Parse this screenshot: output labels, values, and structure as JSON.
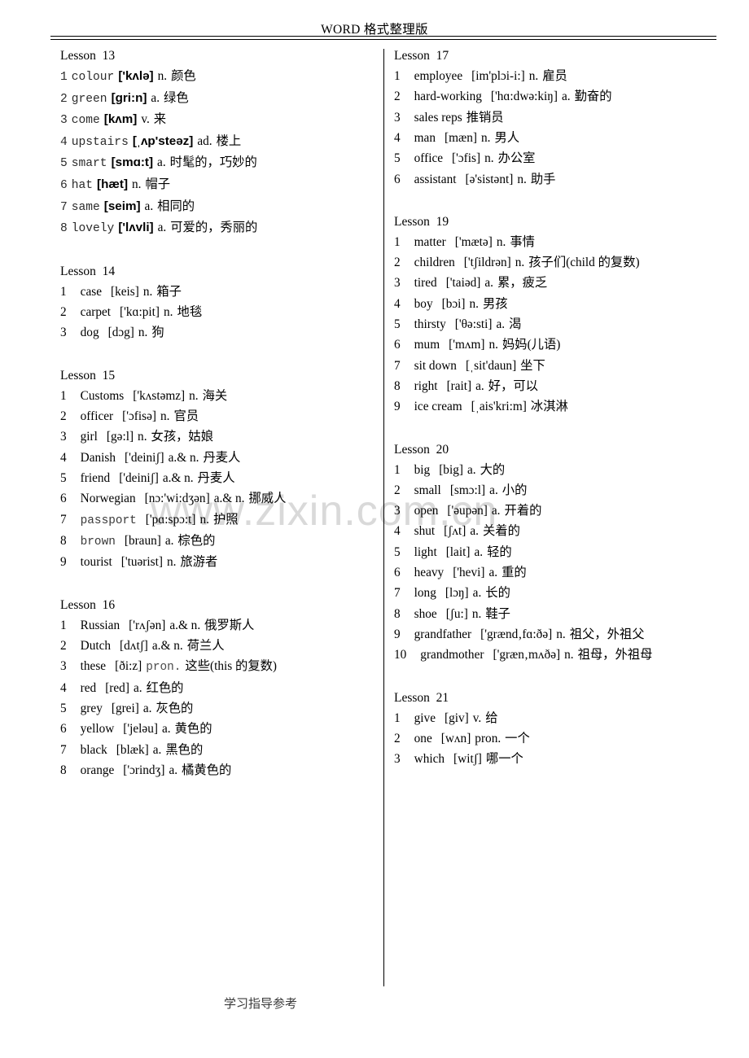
{
  "header": {
    "title": "WORD 格式整理版"
  },
  "footer": {
    "text": "学习指导参考"
  },
  "watermark": {
    "text": "www.zixin.com.cn"
  },
  "left_column": {
    "lessons": [
      {
        "title": "Lesson  13",
        "style": "mono",
        "entries": [
          {
            "num": "1",
            "word": "colour",
            "ipa": "['kʌlə]",
            "pos": "n.",
            "cn": "颜色"
          },
          {
            "num": "2",
            "word": "green",
            "ipa": "[gri:n]",
            "pos": "a.",
            "cn": "绿色"
          },
          {
            "num": "3",
            "word": "come",
            "ipa": "[kʌm]",
            "pos": "v.",
            "cn": "来"
          },
          {
            "num": "4",
            "word": "upstairs",
            "ipa": "[ˌʌp'steəz]",
            "pos": "ad.",
            "cn": "楼上"
          },
          {
            "num": "5",
            "word": "smart",
            "ipa": "[smɑ:t]",
            "pos": "a.",
            "cn": "时髦的，巧妙的"
          },
          {
            "num": "6",
            "word": "hat",
            "ipa": "[hæt]",
            "pos": "n.",
            "cn": "帽子"
          },
          {
            "num": "7",
            "word": "same",
            "ipa": "[seim]",
            "pos": "a.",
            "cn": "相同的"
          },
          {
            "num": "8",
            "word": "lovely",
            "ipa": "['lʌvli]",
            "pos": "a.",
            "cn": "可爱的，秀丽的"
          }
        ]
      },
      {
        "title": "Lesson  14",
        "style": "serif",
        "entries": [
          {
            "num": "1",
            "word": "case",
            "ipa": "[keis]",
            "pos": "n.",
            "cn": "箱子"
          },
          {
            "num": "2",
            "word": "carpet",
            "ipa": "['kɑ:pit]",
            "pos": "n.",
            "cn": "地毯"
          },
          {
            "num": "3",
            "word": "dog",
            "ipa": "[dɔg]",
            "pos": "n.",
            "cn": "狗"
          }
        ]
      },
      {
        "title": "Lesson  15",
        "style": "serif",
        "entries": [
          {
            "num": "1",
            "word": "Customs",
            "ipa": "['kʌstəmz]",
            "pos": "n.",
            "cn": "海关"
          },
          {
            "num": "2",
            "word": "officer",
            "ipa": "['ɔfisə]",
            "pos": "n.",
            "cn": "官员"
          },
          {
            "num": "3",
            "word": "girl",
            "ipa": "[gə:l]",
            "pos": "n.",
            "cn": "女孩，姑娘"
          },
          {
            "num": "4",
            "word": "Danish",
            "ipa": "['deiniʃ]",
            "pos": "a.& n.",
            "cn": "丹麦人"
          },
          {
            "num": "5",
            "word": "friend",
            "ipa": "['deiniʃ]",
            "pos": "a.& n.",
            "cn": "丹麦人"
          },
          {
            "num": "6",
            "word": "Norwegian",
            "ipa": "[nɔ:'wi:dʒən]",
            "pos": "a.& n.",
            "cn": "挪威人"
          },
          {
            "num": "7",
            "word": "passport",
            "ipa": "['pɑ:spɔ:t]",
            "pos": "n.",
            "cn": "护照",
            "word_style": "mono"
          },
          {
            "num": "8",
            "word": "brown",
            "ipa": "[braun]",
            "pos": "a.",
            "cn": "棕色的",
            "word_style": "mono"
          },
          {
            "num": "9",
            "word": "tourist",
            "ipa": "['tuərist]",
            "pos": "n.",
            "cn": "旅游者"
          }
        ]
      },
      {
        "title": "Lesson  16",
        "style": "serif",
        "entries": [
          {
            "num": "1",
            "word": "Russian",
            "ipa": "['rʌʃən]",
            "pos": "a.& n.",
            "cn": "俄罗斯人"
          },
          {
            "num": "2",
            "word": "Dutch",
            "ipa": "[dʌtʃ]",
            "pos": "a.& n.",
            "cn": "荷兰人"
          },
          {
            "num": "3",
            "word": "these",
            "ipa": "[ði:z]",
            "pos": "pron.",
            "cn": "这些(this 的复数)",
            "pos_style": "grey"
          },
          {
            "num": "4",
            "word": "red",
            "ipa": "[red]",
            "pos": "a.",
            "cn": "红色的"
          },
          {
            "num": "5",
            "word": "grey",
            "ipa": "[grei]",
            "pos": "a.",
            "cn": "灰色的"
          },
          {
            "num": "6",
            "word": "yellow",
            "ipa": "['jeləu]",
            "pos": "a.",
            "cn": "黄色的"
          },
          {
            "num": "7",
            "word": "black",
            "ipa": "[blæk]",
            "pos": "a.",
            "cn": "黑色的"
          },
          {
            "num": "8",
            "word": "orange",
            "ipa": "['ɔrindʒ]",
            "pos": "a.",
            "cn": "橘黄色的"
          }
        ]
      }
    ]
  },
  "right_column": {
    "lessons": [
      {
        "title": "Lesson  17",
        "style": "serif",
        "entries": [
          {
            "num": "1",
            "word": "employee",
            "ipa": "[im'plɔi-i:]",
            "pos": "n.",
            "cn": "雇员"
          },
          {
            "num": "2",
            "word": "hard-working",
            "ipa": "['hɑ:dwə:kiŋ]",
            "pos": "a.",
            "cn": "勤奋的"
          },
          {
            "num": "3",
            "word": "sales reps",
            "ipa": "",
            "pos": "",
            "cn": "推销员"
          },
          {
            "num": "4",
            "word": "man",
            "ipa": "[mæn]",
            "pos": "n.",
            "cn": "男人"
          },
          {
            "num": "5",
            "word": "office",
            "ipa": "['ɔfis]",
            "pos": "n.",
            "cn": "办公室"
          },
          {
            "num": "6",
            "word": "assistant",
            "ipa": "[ə'sistənt]",
            "pos": "n.",
            "cn": "助手"
          }
        ]
      },
      {
        "title": "Lesson  19",
        "style": "serif",
        "entries": [
          {
            "num": "1",
            "word": "matter",
            "ipa": "['mætə]",
            "pos": "n.",
            "cn": "事情"
          },
          {
            "num": "2",
            "word": "children",
            "ipa": "['tʃildrən]",
            "pos": "n.",
            "cn": "孩子们(child 的复数)"
          },
          {
            "num": "3",
            "word": "tired",
            "ipa": "['taiəd]",
            "pos": "a.",
            "cn": "累，疲乏"
          },
          {
            "num": "4",
            "word": "boy",
            "ipa": "[bɔi]",
            "pos": "n.",
            "cn": "男孩"
          },
          {
            "num": "5",
            "word": "thirsty",
            "ipa": "['θə:sti]",
            "pos": "a.",
            "cn": "渴"
          },
          {
            "num": "6",
            "word": "mum",
            "ipa": "['mʌm]",
            "pos": "n.",
            "cn": "妈妈(儿语)"
          },
          {
            "num": "7",
            "word": "sit down",
            "ipa": "[ˌsit'daun]",
            "pos": "",
            "cn": "坐下"
          },
          {
            "num": "8",
            "word": "right",
            "ipa": "[rait]",
            "pos": "a.",
            "cn": "好，可以"
          },
          {
            "num": "9",
            "word": "ice cream",
            "ipa": "[ˌais'kri:m]",
            "pos": "",
            "cn": "冰淇淋"
          }
        ]
      },
      {
        "title": "Lesson  20",
        "style": "serif",
        "entries": [
          {
            "num": "1",
            "word": "big",
            "ipa": "[big]",
            "pos": "a.",
            "cn": "大的"
          },
          {
            "num": "2",
            "word": "small",
            "ipa": "[smɔ:l]",
            "pos": "a.",
            "cn": "小的"
          },
          {
            "num": "3",
            "word": "open",
            "ipa": "['əupən]",
            "pos": "a.",
            "cn": "开着的"
          },
          {
            "num": "4",
            "word": "shut",
            "ipa": "[ʃʌt]",
            "pos": "a.",
            "cn": "关着的"
          },
          {
            "num": "5",
            "word": "light",
            "ipa": "[lait]",
            "pos": "a.",
            "cn": "轻的"
          },
          {
            "num": "6",
            "word": "heavy",
            "ipa": "['hevi]",
            "pos": "a.",
            "cn": "重的"
          },
          {
            "num": "7",
            "word": "long",
            "ipa": "[lɔŋ]",
            "pos": "a.",
            "cn": "长的"
          },
          {
            "num": "8",
            "word": "shoe",
            "ipa": "[ʃu:]",
            "pos": "n.",
            "cn": "鞋子"
          },
          {
            "num": "9",
            "word": "grandfather",
            "ipa": "['grænd‚fɑ:ðə]",
            "pos": "n.",
            "cn": "祖父，外祖父"
          },
          {
            "num": "10",
            "word": "grandmother",
            "ipa": "['græn‚mʌðə]",
            "pos": "n.",
            "cn": "祖母，外祖母"
          }
        ]
      },
      {
        "title": "Lesson  21",
        "style": "serif",
        "entries": [
          {
            "num": "1",
            "word": "give",
            "ipa": "[giv]",
            "pos": "v.",
            "cn": "给"
          },
          {
            "num": "2",
            "word": "one",
            "ipa": "[wʌn]",
            "pos": "pron.",
            "cn": "一个"
          },
          {
            "num": "3",
            "word": "which",
            "ipa": "[witʃ]",
            "pos": "",
            "cn": "哪一个"
          }
        ]
      }
    ]
  }
}
